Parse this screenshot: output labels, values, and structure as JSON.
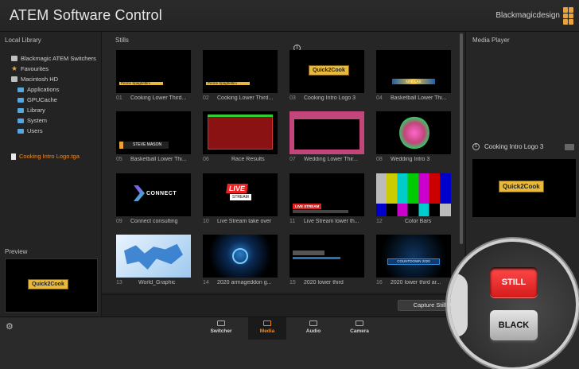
{
  "app": {
    "title": "ATEM Software Control",
    "brand": "Blackmagicdesign"
  },
  "library": {
    "header": "Local Library",
    "items": [
      {
        "label": "Blackmagic ATEM Switchers",
        "icon": "drive-icon"
      },
      {
        "label": "Favourites",
        "icon": "star-icon"
      },
      {
        "label": "Macintosh HD",
        "icon": "drive-icon"
      },
      {
        "label": "Applications",
        "icon": "folder-icon"
      },
      {
        "label": "GPUCache",
        "icon": "folder-icon"
      },
      {
        "label": "Library",
        "icon": "folder-icon"
      },
      {
        "label": "System",
        "icon": "folder-icon"
      },
      {
        "label": "Users",
        "icon": "folder-icon"
      }
    ],
    "selected_file": "Cooking Intro Logo.tga",
    "preview_header": "Preview"
  },
  "stills": {
    "header": "Stills",
    "items": [
      {
        "num": "01",
        "name": "Cooking Lower Third...",
        "thumb_text": "Penne Spaghettini"
      },
      {
        "num": "02",
        "name": "Cooking Lower Third...",
        "thumb_text": "Penne Spaghettini"
      },
      {
        "num": "03",
        "name": "Cooking Intro Logo 3",
        "thumb_text": "Quick2Cook"
      },
      {
        "num": "04",
        "name": "Basketball Lower Thi...",
        "thumb_text": "NYE LAX"
      },
      {
        "num": "05",
        "name": "Basketball Lower Thi...",
        "thumb_text": "STEVE MASON"
      },
      {
        "num": "06",
        "name": "Race Results",
        "thumb_text": ""
      },
      {
        "num": "07",
        "name": "Wedding Lower Thir...",
        "thumb_text": ""
      },
      {
        "num": "08",
        "name": "Wedding Intro 3",
        "thumb_text": ""
      },
      {
        "num": "09",
        "name": "Connect consulting",
        "thumb_text": "CONNECT"
      },
      {
        "num": "10",
        "name": "Live Stream take over",
        "thumb_text": "LIVE"
      },
      {
        "num": "11",
        "name": "Live Stream lower th...",
        "thumb_text": "LIVE STREAM"
      },
      {
        "num": "12",
        "name": "Color Bars",
        "thumb_text": ""
      },
      {
        "num": "13",
        "name": "World_Graphic",
        "thumb_text": ""
      },
      {
        "num": "14",
        "name": "2020 armageddon g...",
        "thumb_text": ""
      },
      {
        "num": "15",
        "name": "2020 lower third",
        "thumb_text": ""
      },
      {
        "num": "16",
        "name": "2020 lower third ar...",
        "thumb_text": "COUNTDOWN 2020"
      }
    ],
    "marker_on_03": "1",
    "capture_button": "Capture Still"
  },
  "media_player": {
    "header": "Media Player",
    "slot_number": "1",
    "slot_name": "Cooking Intro Logo 3",
    "preview_text": "Quick2Cook"
  },
  "tabs": [
    {
      "label": "Switcher",
      "active": false
    },
    {
      "label": "Media",
      "active": true
    },
    {
      "label": "Audio",
      "active": false
    },
    {
      "label": "Camera",
      "active": false
    }
  ],
  "magnifier": {
    "still_key": "STILL",
    "black_key": "BLACK"
  },
  "colors": {
    "accent": "#f08a24",
    "still_key": "#e02020",
    "folder": "#56a7e0"
  }
}
